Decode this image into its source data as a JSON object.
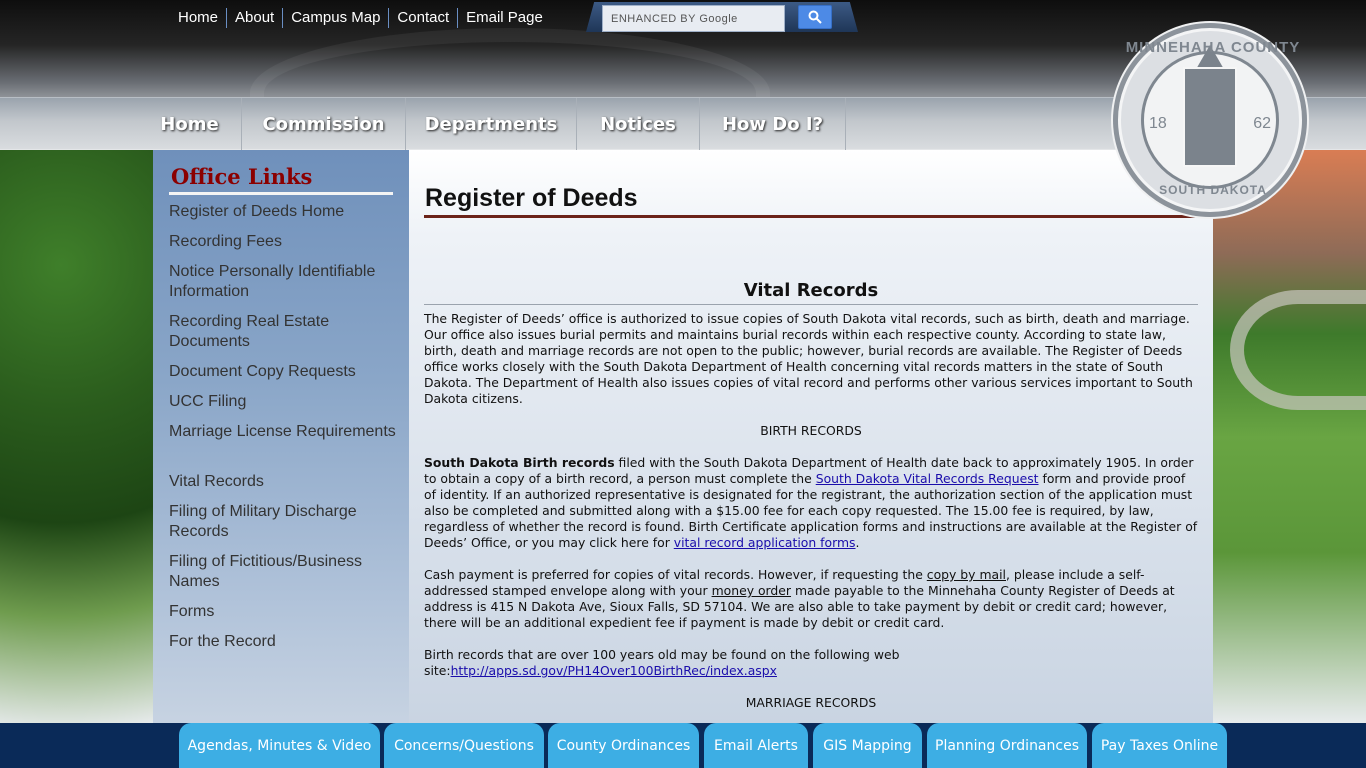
{
  "top_links": [
    "Home",
    "About",
    "Campus Map",
    "Contact",
    "Email Page"
  ],
  "search": {
    "placeholder": "ENHANCED BY Google",
    "button_icon": "search-icon"
  },
  "main_nav": [
    "Home",
    "Commission",
    "Departments",
    "Notices",
    "How Do I?"
  ],
  "seal": {
    "top_text": "MINNEHAHA COUNTY",
    "bottom_text": "SOUTH DAKOTA",
    "year_left": "18",
    "year_right": "62"
  },
  "sidebar": {
    "title": "Office Links",
    "links": [
      "Register of Deeds Home",
      "Recording Fees",
      "Notice Personally Identifiable Information",
      "Recording Real Estate Documents",
      "Document Copy Requests",
      "UCC Filing",
      "Marriage License Requirements",
      "Vital Records",
      "Filing of Military Discharge Records",
      "Filing of Fictitious/Business Names",
      "Forms",
      "For the Record"
    ]
  },
  "content": {
    "page_title": "Register of Deeds",
    "section_heading": "Vital Records",
    "intro": "The Register of Deeds’ office is authorized to issue copies of South Dakota vital records, such as birth, death and marriage.  Our office also issues burial permits and maintains burial records within each respective county.  According to state law, birth, death and marriage records are not open to the public; however, burial records are available.  The Register of Deeds office works closely with the South Dakota Department of Health concerning vital records matters in the state of South Dakota.  The Department of Health also issues copies of vital record and performs other various services important to South Dakota citizens.",
    "birth_heading": "BIRTH RECORDS",
    "birth_bold": "South Dakota Birth records",
    "birth_text_1": " filed with the South Dakota Department of Health date back to approximately 1905. In order to obtain a copy of a birth record, a person must complete the ",
    "birth_link_1": "South Dakota Vital Records Request",
    "birth_text_2": " form and provide proof of identity. If an authorized representative is designated for the registrant, the authorization section of the application must also be completed and submitted along with a $15.00 fee for each copy requested. The 15.00 fee is required, by law, regardless of whether the record is found. Birth Certificate application forms and instructions are available at the Register of Deeds’ Office, or you may click here for ",
    "birth_link_2": "vital record application forms",
    "birth_text_3": ".",
    "cash_text_1": "Cash payment is preferred for copies of vital records. However, if requesting the ",
    "cash_u_1": "copy by mail",
    "cash_text_2": ", please include a self-addressed stamped envelope along with your ",
    "cash_u_2": "money order",
    "cash_text_3": " made payable to the Minnehaha County Register of Deeds at address is 415 N Dakota Ave, Sioux Falls, SD 57104. We are also able to take payment by debit or credit card; however, there will be an additional expedient fee if payment is made by debit or credit card.",
    "old_text": "Birth records that are over 100 years old may be found on the following web site:",
    "old_link": "http://apps.sd.gov/PH14Over100BirthRec/index.aspx",
    "marriage_heading": "MARRIAGE RECORDS"
  },
  "quick_links": [
    "Agendas, Minutes & Video",
    "Concerns/Questions",
    "County Ordinances",
    "Email Alerts",
    "GIS Mapping",
    "Planning Ordinances",
    "Pay Taxes Online"
  ],
  "colors": {
    "header_dark": "#0e0e0e",
    "sidebar_blue": "#6f90bb",
    "title_red": "#8b0000",
    "bottom_bar": "#0a2a58",
    "quick_btn": "#3daee4"
  }
}
